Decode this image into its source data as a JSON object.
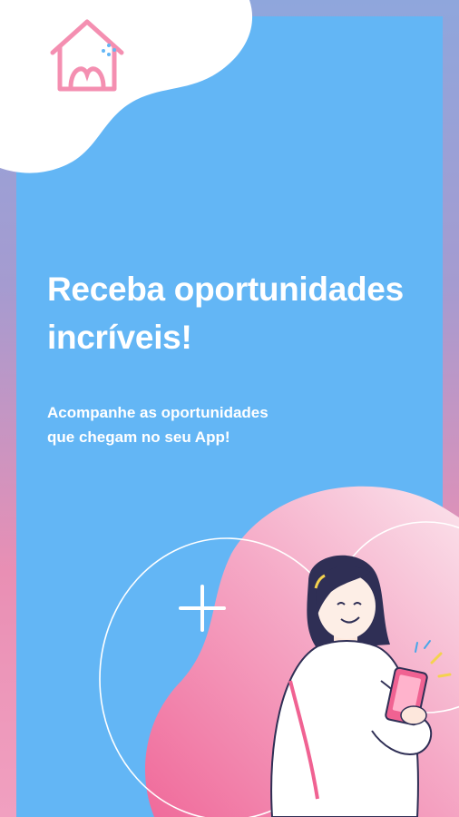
{
  "onboarding": {
    "headline": "Receba oportunidades incríveis!",
    "subtext_line1": "Acompanhe as oportunidades",
    "subtext_line2": "que chegam no seu App!"
  },
  "colors": {
    "panel": "#63b6f5",
    "accent_pink": "#f06292",
    "logo_pink": "#f48fb1",
    "white": "#ffffff"
  },
  "icons": {
    "logo": "house-heart-logo",
    "plus": "plus-icon",
    "illustration": "woman-with-phone-illustration"
  }
}
